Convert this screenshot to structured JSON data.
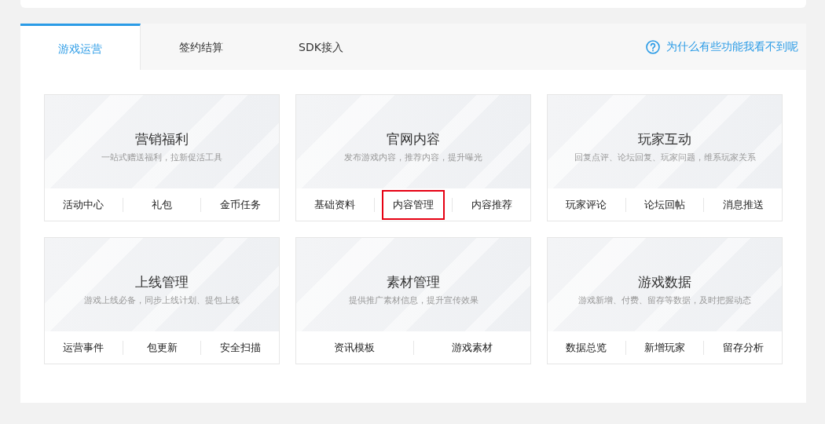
{
  "tabs": [
    {
      "label": "游戏运营",
      "selected": true
    },
    {
      "label": "签约结算",
      "selected": false
    },
    {
      "label": "SDK接入",
      "selected": false
    }
  ],
  "help_link": "为什么有些功能我看不到呢",
  "cards": [
    {
      "title": "营销福利",
      "subtitle": "一站式赠送福利，拉新促活工具",
      "links": [
        {
          "label": "活动中心",
          "highlighted": false
        },
        {
          "label": "礼包",
          "highlighted": false
        },
        {
          "label": "金币任务",
          "highlighted": false
        }
      ]
    },
    {
      "title": "官网内容",
      "subtitle": "发布游戏内容，推荐内容，提升曝光",
      "links": [
        {
          "label": "基础资料",
          "highlighted": false
        },
        {
          "label": "内容管理",
          "highlighted": true
        },
        {
          "label": "内容推荐",
          "highlighted": false
        }
      ]
    },
    {
      "title": "玩家互动",
      "subtitle": "回复点评、论坛回复、玩家问题，维系玩家关系",
      "links": [
        {
          "label": "玩家评论",
          "highlighted": false
        },
        {
          "label": "论坛回帖",
          "highlighted": false
        },
        {
          "label": "消息推送",
          "highlighted": false
        }
      ]
    },
    {
      "title": "上线管理",
      "subtitle": "游戏上线必备，同步上线计划、提包上线",
      "links": [
        {
          "label": "运营事件",
          "highlighted": false
        },
        {
          "label": "包更新",
          "highlighted": false
        },
        {
          "label": "安全扫描",
          "highlighted": false
        }
      ]
    },
    {
      "title": "素材管理",
      "subtitle": "提供推广素材信息，提升宣传效果",
      "links": [
        {
          "label": "资讯模板",
          "highlighted": false
        },
        {
          "label": "游戏素材",
          "highlighted": false
        }
      ]
    },
    {
      "title": "游戏数据",
      "subtitle": "游戏新增、付费、留存等数据，及时把握动态",
      "links": [
        {
          "label": "数据总览",
          "highlighted": false
        },
        {
          "label": "新增玩家",
          "highlighted": false
        },
        {
          "label": "留存分析",
          "highlighted": false
        }
      ]
    }
  ]
}
